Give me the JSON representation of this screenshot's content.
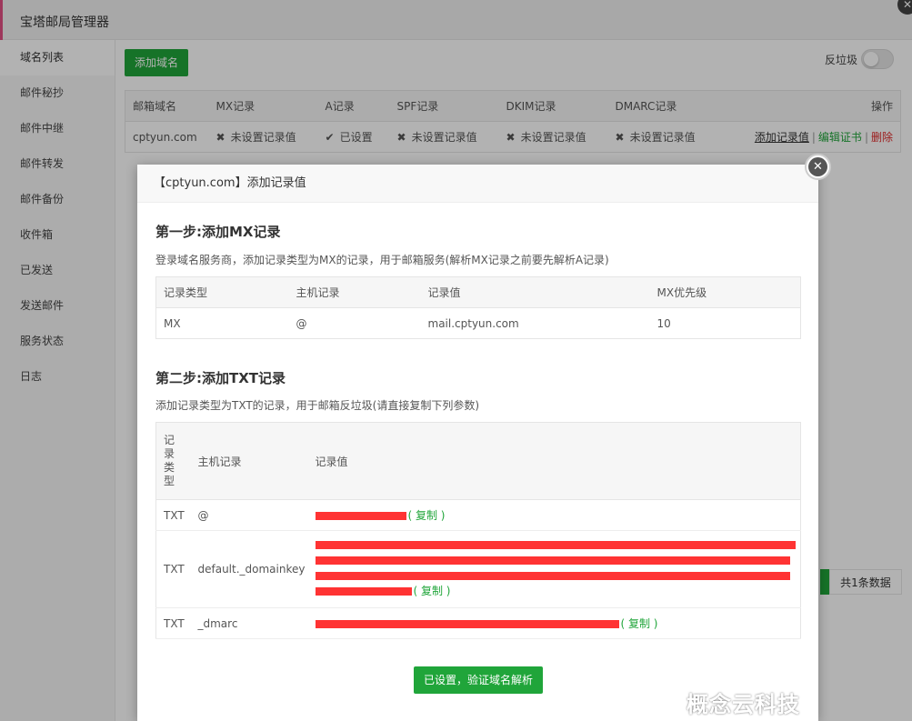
{
  "app": {
    "title": "宝塔邮局管理器"
  },
  "sidebar": {
    "items": [
      {
        "label": "域名列表"
      },
      {
        "label": "邮件秘抄"
      },
      {
        "label": "邮件中继"
      },
      {
        "label": "邮件转发"
      },
      {
        "label": "邮件备份"
      },
      {
        "label": "收件箱"
      },
      {
        "label": "已发送"
      },
      {
        "label": "发送邮件"
      },
      {
        "label": "服务状态"
      },
      {
        "label": "日志"
      }
    ]
  },
  "toolbar": {
    "add_domain": "添加域名",
    "spam_label": "反垃圾"
  },
  "domain_table": {
    "headers": [
      "邮箱域名",
      "MX记录",
      "A记录",
      "SPF记录",
      "DKIM记录",
      "DMARC记录",
      "操作"
    ],
    "row": {
      "domain": "cptyun.com",
      "mx": "未设置记录值",
      "a": "已设置",
      "spf": "未设置记录值",
      "dkim": "未设置记录值",
      "dmarc": "未设置记录值",
      "ops": [
        "添加记录值",
        "编辑证书",
        "删除"
      ]
    }
  },
  "pager": {
    "total": "共1条数据"
  },
  "dialog": {
    "title": "【cptyun.com】添加记录值",
    "step1": {
      "title": "第一步:添加MX记录",
      "desc": "登录域名服务商，添加记录类型为MX的记录，用于邮箱服务(解析MX记录之前要先解析A记录)",
      "headers": [
        "记录类型",
        "主机记录",
        "记录值",
        "MX优先级"
      ],
      "row": [
        "MX",
        "@",
        "mail.cptyun.com",
        "10"
      ]
    },
    "step2": {
      "title": "第二步:添加TXT记录",
      "desc": "添加记录类型为TXT的记录，用于邮箱反垃圾(请直接复制下列参数)",
      "headers": [
        "记录类型",
        "主机记录",
        "记录值"
      ],
      "rows": [
        {
          "type": "TXT",
          "host": "@"
        },
        {
          "type": "TXT",
          "host": "default._domainkey"
        },
        {
          "type": "TXT",
          "host": "_dmarc"
        }
      ],
      "copy_label": "( 复制 )"
    },
    "verify_button": "已设置，验证域名解析"
  },
  "watermark": "概念云科技",
  "colors": {
    "accent": "#20a53a",
    "danger": "#e02a2a",
    "redaction": "#ff3333"
  }
}
